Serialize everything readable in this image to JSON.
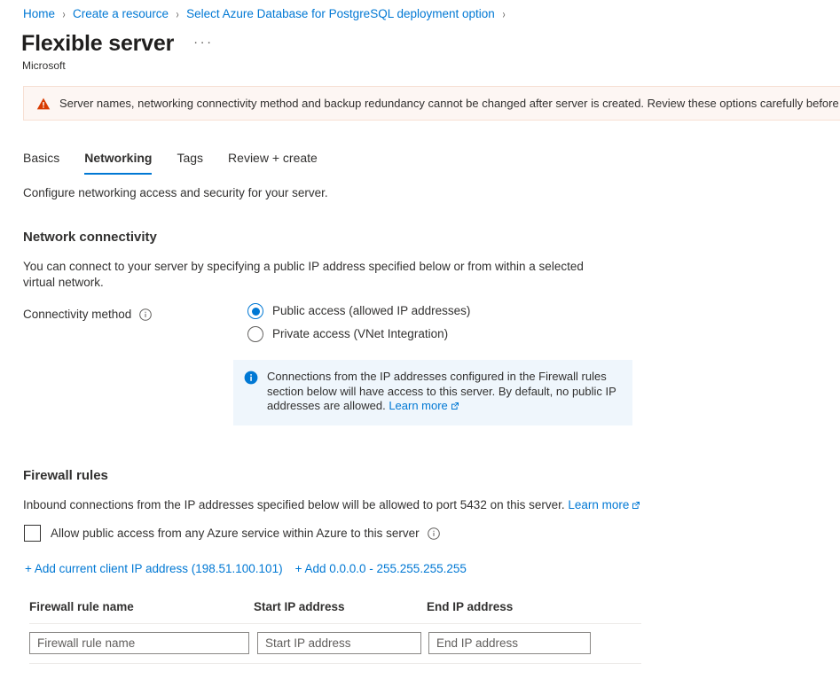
{
  "breadcrumb": {
    "items": [
      {
        "label": "Home"
      },
      {
        "label": "Create a resource"
      },
      {
        "label": "Select Azure Database for PostgreSQL deployment option"
      }
    ],
    "separator": "›"
  },
  "header": {
    "title": "Flexible server",
    "subtitle": "Microsoft",
    "ellipsis": "···"
  },
  "warning": {
    "icon": "warning-triangle-icon",
    "text": "Server names, networking connectivity method and backup redundancy cannot be changed after server is created. Review these options carefully before provisioning",
    "background": "#fdf6f3",
    "icon_color": "#d83b01"
  },
  "tabs": [
    {
      "label": "Basics",
      "active": false
    },
    {
      "label": "Networking",
      "active": true
    },
    {
      "label": "Tags",
      "active": false
    },
    {
      "label": "Review + create",
      "active": false
    }
  ],
  "main": {
    "intro": "Configure networking access and security for your server.",
    "network_connectivity": {
      "heading": "Network connectivity",
      "description": "You can connect to your server by specifying a public IP address specified below or from within a selected virtual network.",
      "connectivity_method": {
        "label": "Connectivity method",
        "info_icon": "info-circle-icon",
        "options": [
          {
            "label": "Public access (allowed IP addresses)",
            "selected": true
          },
          {
            "label": "Private access (VNet Integration)",
            "selected": false
          }
        ]
      },
      "info_box": {
        "icon": "info-circle-filled-icon",
        "text": "Connections from the IP addresses configured in the Firewall rules section below will have access to this server. By default, no public IP addresses are allowed. ",
        "link_label": "Learn more",
        "link_icon": "external-link-icon",
        "background": "#eff6fc"
      }
    },
    "firewall_rules": {
      "heading": "Firewall rules",
      "description_prefix": "Inbound connections from the IP addresses specified below will be allowed to port 5432 on this server. ",
      "description_link": "Learn more",
      "description_link_icon": "external-link-icon",
      "port": "5432",
      "allow_azure_checkbox": {
        "label": "Allow public access from any Azure service within Azure to this server",
        "checked": false,
        "info_icon": "info-circle-icon"
      },
      "add_links": [
        {
          "label": "+ Add current client IP address (198.51.100.101)"
        },
        {
          "label": "+ Add 0.0.0.0 - 255.255.255.255"
        }
      ],
      "client_ip": "198.51.100.101",
      "table": {
        "columns": [
          "Firewall rule name",
          "Start IP address",
          "End IP address"
        ],
        "rows": [
          {
            "name_value": "",
            "name_placeholder": "Firewall rule name",
            "start_value": "",
            "start_placeholder": "Start IP address",
            "end_value": "",
            "end_placeholder": "End IP address"
          }
        ]
      }
    }
  },
  "colors": {
    "accent": "#0078d4",
    "text": "#323130",
    "warning_bg": "#fdf6f3",
    "info_bg": "#eff6fc"
  }
}
